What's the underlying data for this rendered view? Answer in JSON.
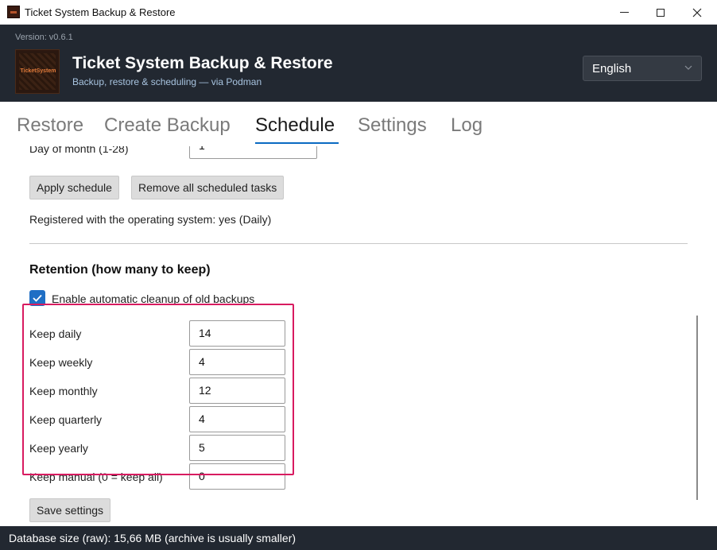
{
  "window": {
    "title": "Ticket System Backup & Restore"
  },
  "header": {
    "version": "Version: v0.6.1",
    "logo_text": "TicketSystem",
    "title": "Ticket System Backup & Restore",
    "subtitle": "Backup, restore & scheduling — via Podman",
    "language": "English"
  },
  "tabs": [
    {
      "label": "Restore",
      "active": false
    },
    {
      "label": "Create Backup",
      "active": false
    },
    {
      "label": "Schedule",
      "active": true
    },
    {
      "label": "Settings",
      "active": false
    },
    {
      "label": "Log",
      "active": false
    }
  ],
  "schedule": {
    "day_of_month_label": "Day of month (1-28)",
    "day_of_month_value": "1",
    "apply_label": "Apply schedule",
    "remove_label": "Remove all scheduled tasks",
    "registration_status": "Registered with the operating system: yes (Daily)"
  },
  "retention": {
    "title": "Retention (how many to keep)",
    "cleanup_label": "Enable automatic cleanup of old backups",
    "cleanup_enabled": true,
    "fields": [
      {
        "label": "Keep daily",
        "value": "14"
      },
      {
        "label": "Keep weekly",
        "value": "4"
      },
      {
        "label": "Keep monthly",
        "value": "12"
      },
      {
        "label": "Keep quarterly",
        "value": "4"
      },
      {
        "label": "Keep yearly",
        "value": "5"
      },
      {
        "label": "Keep manual (0 = keep all)",
        "value": "0"
      }
    ],
    "save_label": "Save settings"
  },
  "status": {
    "text": "Database size (raw): 15,66 MB (archive is usually smaller)"
  },
  "colors": {
    "header_bg": "#222831",
    "accent": "#0a6ac2",
    "checkbox": "#1f6fc5",
    "highlight": "#d81b60"
  }
}
